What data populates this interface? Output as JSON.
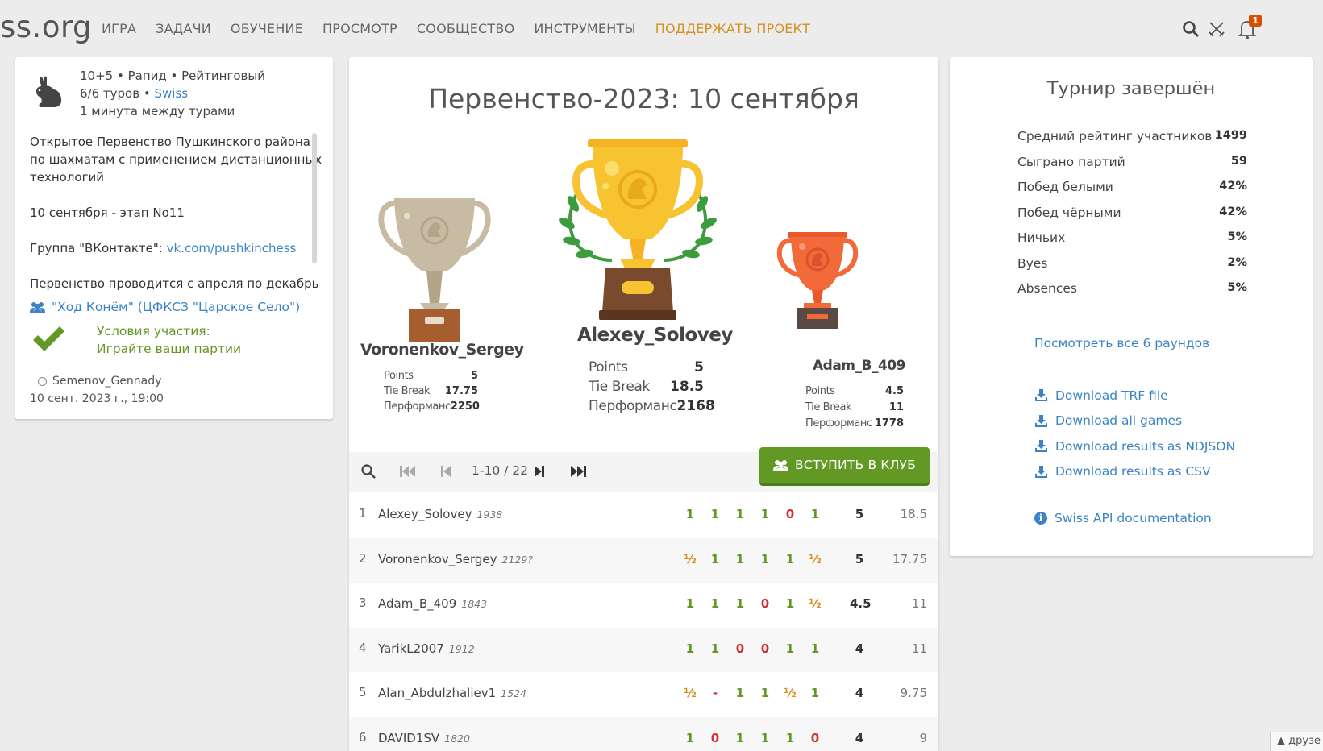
{
  "nav": {
    "logo": "ss.org",
    "links": [
      "ИГРА",
      "ЗАДАЧИ",
      "ОБУЧЕНИЕ",
      "ПРОСМОТР",
      "СООБЩЕСТВО",
      "ИНСТРУМЕНТЫ"
    ],
    "donate": "ПОДДЕРЖАТЬ ПРОЕКТ",
    "notifications": "1",
    "icons": [
      "search-icon",
      "swords-icon",
      "bell-icon"
    ]
  },
  "info": {
    "line1": "10+5 • Рапид • Рейтинговый",
    "rounds": "6/6 туров • ",
    "system": "Swiss",
    "interval": "1 минута между турами",
    "desc1": "Открытое Первенство Пушкинского района по шахматам с применением дистанционных технологий",
    "desc2": "10 сентября - этап No11",
    "desc3_prefix": "Группа \"ВКонтакте\": ",
    "desc3_link": "vk.com/pushkinchess",
    "desc4": "Первенство проводится с апреля по декабрь",
    "team": "\"Ход Конём\" (ЦФКСЗ \"Царское Село\")",
    "cond_label": "Условия участия:",
    "cond_value": "Играйте ваши партии",
    "creator": "Semenov_Gennady",
    "date": "10 сент. 2023 г., 19:00"
  },
  "center": {
    "title": "Первенство-2023: 10 сентября",
    "podium": {
      "first": {
        "name": "Alexey_Solovey",
        "points": "5",
        "tiebreak": "18.5",
        "perf": "2168"
      },
      "second": {
        "name": "Voronenkov_Sergey",
        "points": "5",
        "tiebreak": "17.75",
        "perf": "2250"
      },
      "third": {
        "name": "Adam_B_409",
        "points": "4.5",
        "tiebreak": "11",
        "perf": "1778"
      }
    },
    "labels": {
      "points": "Points",
      "tiebreak": "Tie Break",
      "perf": "Перформанс"
    },
    "pager": "1-10 / 22",
    "join": "ВСТУПИТЬ В КЛУБ",
    "players": [
      {
        "rank": "1",
        "name": "Alexey_Solovey",
        "rating": "1938",
        "results": [
          "1",
          "1",
          "1",
          "1",
          "0",
          "1"
        ],
        "points": "5",
        "tb": "18.5"
      },
      {
        "rank": "2",
        "name": "Voronenkov_Sergey",
        "rating": "2129?",
        "results": [
          "½",
          "1",
          "1",
          "1",
          "1",
          "½"
        ],
        "points": "5",
        "tb": "17.75"
      },
      {
        "rank": "3",
        "name": "Adam_B_409",
        "rating": "1843",
        "results": [
          "1",
          "1",
          "1",
          "0",
          "1",
          "½"
        ],
        "points": "4.5",
        "tb": "11"
      },
      {
        "rank": "4",
        "name": "YarikL2007",
        "rating": "1912",
        "results": [
          "1",
          "1",
          "0",
          "0",
          "1",
          "1"
        ],
        "points": "4",
        "tb": "11"
      },
      {
        "rank": "5",
        "name": "Alan_Abdulzhaliev1",
        "rating": "1524",
        "results": [
          "½",
          "-",
          "1",
          "1",
          "½",
          "1"
        ],
        "points": "4",
        "tb": "9.75"
      },
      {
        "rank": "6",
        "name": "DAVID1SV",
        "rating": "1820",
        "results": [
          "1",
          "0",
          "1",
          "1",
          "1",
          "0"
        ],
        "points": "4",
        "tb": "9"
      }
    ]
  },
  "summary": {
    "title": "Турнир завершён",
    "stats": [
      {
        "label": "Средний рейтинг участников",
        "value": "1499"
      },
      {
        "label": "Сыграно партий",
        "value": "59"
      },
      {
        "label": "Побед белыми",
        "value": "42%"
      },
      {
        "label": "Побед чёрными",
        "value": "42%"
      },
      {
        "label": "Ничьих",
        "value": "5%"
      },
      {
        "label": "Byes",
        "value": "2%"
      },
      {
        "label": "Absences",
        "value": "5%"
      }
    ],
    "rounds_link": "Посмотреть все 6 раундов",
    "downloads": [
      "Download TRF file",
      "Download all games",
      "Download results as NDJSON",
      "Download results as CSV"
    ],
    "api": "Swiss API documentation"
  },
  "friends": "друзе",
  "colors": {
    "win": "#629924",
    "loss": "#cc3333",
    "draw": "#d59120",
    "link": "#3b83c4",
    "gold": "#f7c331",
    "silver": "#c8bba3",
    "bronze": "#f2693a"
  }
}
